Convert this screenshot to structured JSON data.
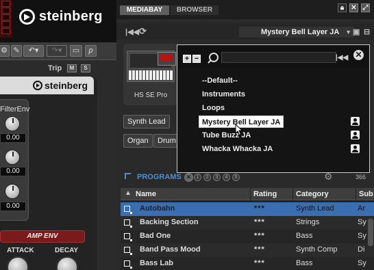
{
  "left_panel": {
    "brand": "steinberg",
    "toolbar": {
      "p_label": "p"
    },
    "trip": {
      "label": "Trip",
      "m": "M",
      "s": "S"
    },
    "instrument": {
      "brand": "steinberg",
      "filter_env_label": "FilterEnv",
      "knob_values": [
        "0.00",
        "0.00",
        "0.00"
      ],
      "amp_env_label": "AMP ENV",
      "attack_label": "ATTACK",
      "decay_label": "DECAY"
    }
  },
  "mediabay": {
    "tabs": [
      {
        "label": "MEDIABAY",
        "active": true
      },
      {
        "label": "BROWSER",
        "active": false
      }
    ],
    "window_buttons": [
      "lock-icon",
      "close-icon",
      "restore-icon"
    ],
    "preset_name": "Mystery Bell Layer JA",
    "thumbnail_label": "HS SE Pro",
    "tag_buttons": [
      "Synth Lead",
      "Organ",
      "Drum"
    ],
    "programs": {
      "title": "PROGRAMS",
      "pages": [
        "1",
        "2",
        "3",
        "4",
        "5"
      ],
      "count": "366"
    },
    "table": {
      "columns": [
        "Name",
        "Rating",
        "Category",
        "Sub"
      ],
      "rows": [
        {
          "name": "Autobahn",
          "rating": "***",
          "category": "Synth Lead",
          "sub": "Ar",
          "selected": true
        },
        {
          "name": "Backing Section",
          "rating": "***",
          "category": "Strings",
          "sub": "Sy"
        },
        {
          "name": "Bad One",
          "rating": "***",
          "category": "Bass",
          "sub": "Sy"
        },
        {
          "name": "Band Pass Mood",
          "rating": "***",
          "category": "Synth Comp",
          "sub": "Di"
        },
        {
          "name": "Bass Lab",
          "rating": "***",
          "category": "Bass",
          "sub": "Sy"
        }
      ]
    }
  },
  "popup": {
    "items": [
      {
        "label": "--Default--",
        "user": false
      },
      {
        "label": "Instruments",
        "user": false
      },
      {
        "label": "Loops",
        "user": false
      },
      {
        "label": "Mystery Bell Layer JA",
        "user": true,
        "highlighted": true
      },
      {
        "label": "Tube Buzz JA",
        "user": true
      },
      {
        "label": "Whacka Whacka JA",
        "user": true
      }
    ]
  },
  "colors": {
    "accent": "#4a8fd8",
    "selection": "#3b6eb0",
    "amp_env": "#7a1a1a"
  }
}
